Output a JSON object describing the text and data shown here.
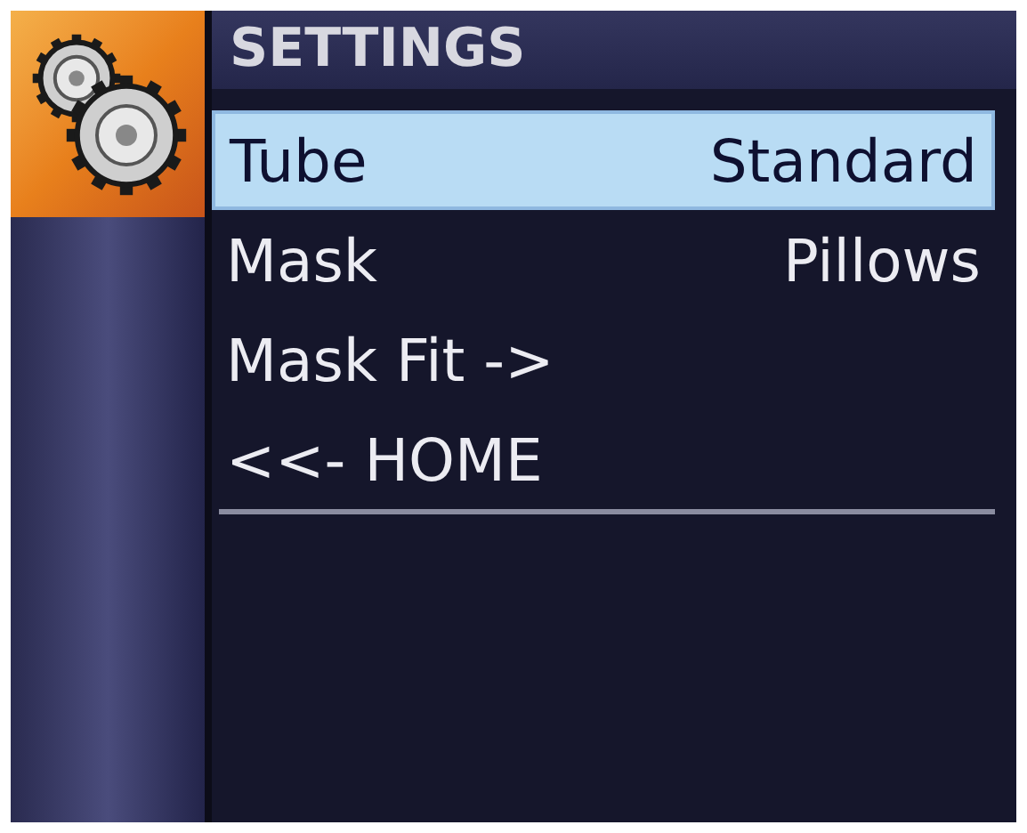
{
  "title": "SETTINGS",
  "items": [
    {
      "label": "Tube",
      "value": "Standard",
      "selected": true
    },
    {
      "label": "Mask",
      "value": "Pillows",
      "selected": false
    },
    {
      "label": "Mask Fit ->",
      "selected": false
    },
    {
      "label": "<<- HOME",
      "selected": false
    }
  ]
}
